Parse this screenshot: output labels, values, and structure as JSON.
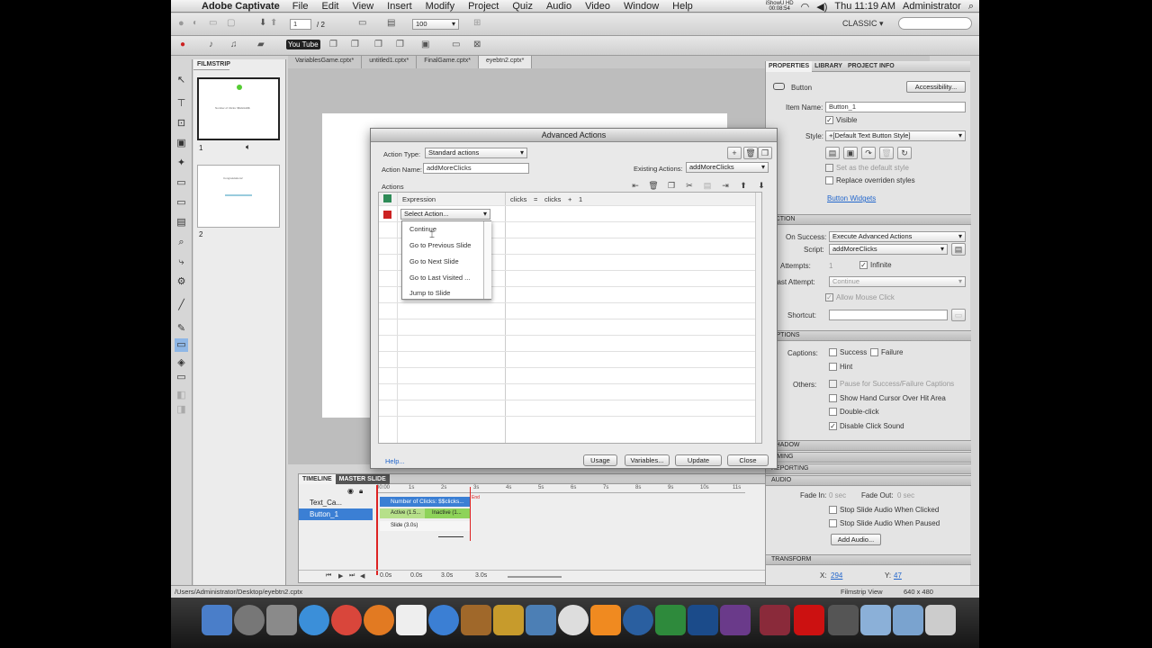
{
  "menubar": {
    "app_name": "Adobe Captivate",
    "items": [
      "File",
      "Edit",
      "View",
      "Insert",
      "Modify",
      "Project",
      "Quiz",
      "Audio",
      "Video",
      "Window",
      "Help"
    ],
    "recorder": "iShowU HD",
    "recorder_time": "00:08:54",
    "clock": "Thu 11:19 AM",
    "user": "Administrator"
  },
  "toolbar": {
    "page_current": "1",
    "page_total": "/ 2",
    "zoom": "100",
    "workspace": "CLASSIC ▾",
    "youtube": "You Tube"
  },
  "document_tabs": [
    "VariablesGame.cptx*",
    "untitled1.cptx*",
    "FinalGame.cptx*",
    "eyebtn2.cptx*"
  ],
  "filmstrip": {
    "header": "FILMSTRIP",
    "slides": [
      {
        "number": "1",
        "caption": "Number of Clicks: $$clicks$$"
      },
      {
        "number": "2",
        "caption": "Congratulations!"
      }
    ]
  },
  "timeline": {
    "tabs": [
      "TIMELINE",
      "MASTER SLIDE"
    ],
    "rows": [
      "Text_Ca...",
      "Button_1"
    ],
    "tracks": [
      "Number of Clicks: $$clicks...",
      "Active (1.5...",
      "Inactive (1...",
      "Slide (3.0s)"
    ],
    "ruler": [
      "00:00",
      "1s",
      "2s",
      "3s",
      "4s",
      "5s",
      "6s",
      "7s",
      "8s",
      "9s",
      "10s",
      "11s"
    ],
    "end_label": "End",
    "footer": [
      "0.0s",
      "0.0s",
      "3.0s",
      "3.0s"
    ]
  },
  "properties": {
    "tabs": [
      "PROPERTIES",
      "LIBRARY",
      "PROJECT INFO"
    ],
    "object_type": "Button",
    "accessibility_button": "Accessibility...",
    "item_name_label": "Item Name:",
    "item_name": "Button_1",
    "visible_label": "Visible",
    "style_label": "Style:",
    "style_value": "+[Default Text Button Style]",
    "set_default": "Set as the default style",
    "replace_styles": "Replace overriden styles",
    "widgets_link": "Button Widgets",
    "action_section": "ACTION",
    "on_success_label": "On Success:",
    "on_success": "Execute Advanced Actions",
    "script_label": "Script:",
    "script": "addMoreClicks",
    "attempts_label": "Attempts:",
    "attempts": "1",
    "infinite_label": "Infinite",
    "last_attempt_label": "Last Attempt:",
    "last_attempt": "Continue",
    "allow_mouse_click": "Allow Mouse Click",
    "shortcut_label": "Shortcut:",
    "options_section": "OPTIONS",
    "captions_label": "Captions:",
    "success_label": "Success",
    "failure_label": "Failure",
    "hint_label": "Hint",
    "others_label": "Others:",
    "pause_label": "Pause for Success/Failure Captions",
    "hand_cursor_label": "Show Hand Cursor Over Hit Area",
    "double_click_label": "Double-click",
    "disable_sound_label": "Disable Click Sound",
    "shadow_section": "SHADOW",
    "timing_section": "TIMING",
    "reporting_section": "REPORTING",
    "audio_section": "AUDIO",
    "fade_in_label": "Fade In:",
    "fade_in": "0 sec",
    "fade_out_label": "Fade Out:",
    "fade_out": "0 sec",
    "stop_clicked": "Stop Slide Audio When Clicked",
    "stop_paused": "Stop Slide Audio When Paused",
    "add_audio": "Add Audio...",
    "transform_section": "TRANSFORM",
    "x_label": "X:",
    "x_value": "294",
    "y_label": "Y:",
    "y_value": "47"
  },
  "dialog": {
    "title": "Advanced Actions",
    "action_type_label": "Action Type:",
    "action_type": "Standard actions",
    "action_name_label": "Action Name:",
    "action_name": "addMoreClicks",
    "existing_label": "Existing Actions:",
    "existing_value": "addMoreClicks",
    "actions_label": "Actions",
    "row1_type": "Expression",
    "row1_expr": [
      "clicks",
      "=",
      "clicks",
      "+",
      "1"
    ],
    "select_action": "Select Action...",
    "dropdown_items": [
      "Continue",
      "Go to Previous Slide",
      "Go to Next Slide",
      "Go to Last Visited ...",
      "Jump to Slide"
    ],
    "help_link": "Help...",
    "buttons": [
      "Usage",
      "Variables...",
      "Update",
      "Close"
    ]
  },
  "statusbar": {
    "path": "/Users/Administrator/Desktop/eyebtn2.cptx",
    "view": "Filmstrip View",
    "size": "640 x 480"
  },
  "colors": {
    "accent": "#3b7fd4",
    "selected_row": "#3b7fd4",
    "expression_marker": "#2e8b57",
    "new_row_marker": "#cc2222"
  }
}
